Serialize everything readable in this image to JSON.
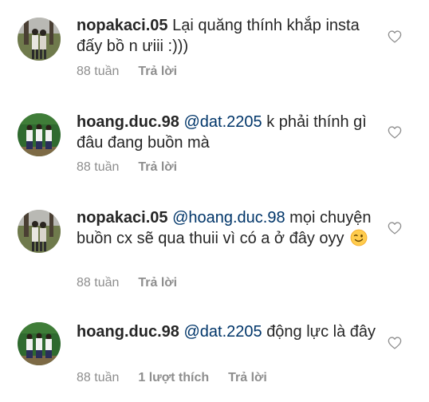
{
  "comments": [
    {
      "username": "nopakaci.05",
      "mention": "",
      "text": "Lại quăng thính khắp insta đấy bồ n ưiii :)))",
      "time": "88 tuần",
      "likes": "",
      "reply_label": "Trả lời",
      "avatar": "avatar-photo-two-people-outdoors"
    },
    {
      "username": "hoang.duc.98",
      "mention": "@dat.2205",
      "text": "k phải thính gì đâu đang buồn mà",
      "time": "88 tuần",
      "likes": "",
      "reply_label": "Trả lời",
      "avatar": "avatar-photo-three-people"
    },
    {
      "username": "nopakaci.05",
      "mention": "@hoang.duc.98",
      "text": "mọi chuyện buồn cx sẽ qua thuii vì có a ở đây oyy",
      "emoji": "winking-face-emoji",
      "time": "88 tuần",
      "likes": "",
      "reply_label": "Trả lời",
      "avatar": "avatar-photo-two-people-outdoors"
    },
    {
      "username": "hoang.duc.98",
      "mention": "@dat.2205",
      "text": "động lực là đây",
      "time": "88 tuần",
      "likes": "1 lượt thích",
      "reply_label": "Trả lời",
      "avatar": "avatar-photo-three-people"
    }
  ],
  "colors": {
    "text": "#262626",
    "mention": "#003569",
    "meta": "#8e8e8e",
    "heart_stroke": "#8e8e8e"
  },
  "icons": {
    "like": "heart-outline-icon"
  }
}
